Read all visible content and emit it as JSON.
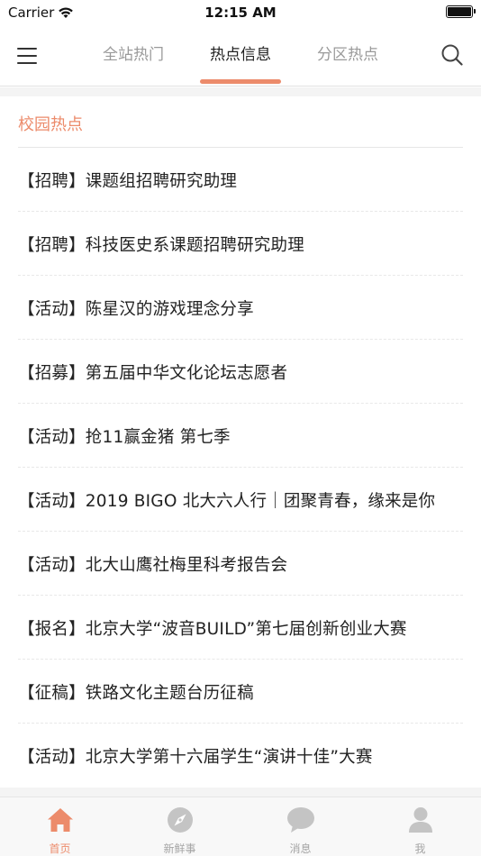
{
  "status_bar": {
    "carrier": "Carrier",
    "time": "12:15 AM"
  },
  "nav": {
    "tabs": [
      {
        "label": "全站热门",
        "active": false
      },
      {
        "label": "热点信息",
        "active": true
      },
      {
        "label": "分区热点",
        "active": false
      }
    ],
    "accent_color": "#ec8b6b"
  },
  "section": {
    "title": "校园热点"
  },
  "items": [
    "【招聘】课题组招聘研究助理",
    "【招聘】科技医史系课题招聘研究助理",
    "【活动】陈星汉的游戏理念分享",
    "【招募】第五届中华文化论坛志愿者",
    "【活动】抢11赢金猪 第七季",
    "【活动】2019 BIGO 北大六人行｜团聚青春，缘来是你",
    "【活动】北大山鹰社梅里科考报告会",
    "【报名】北京大学“波音BUILD”第七届创新创业大赛",
    "【征稿】铁路文化主题台历征稿",
    "【活动】北京大学第十六届学生“演讲十佳”大赛"
  ],
  "tab_bar": {
    "items": [
      {
        "label": "首页",
        "icon": "home-icon",
        "active": true
      },
      {
        "label": "新鲜事",
        "icon": "compass-icon",
        "active": false
      },
      {
        "label": "消息",
        "icon": "chat-bubble-icon",
        "active": false
      },
      {
        "label": "我",
        "icon": "person-icon",
        "active": false
      }
    ],
    "active_color": "#ec8b6b",
    "inactive_color": "#c4c4c4"
  }
}
